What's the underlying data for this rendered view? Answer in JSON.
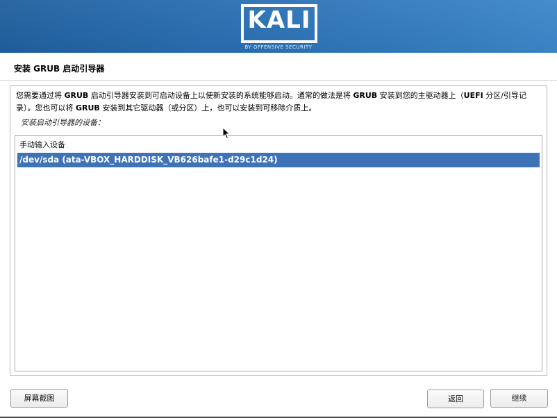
{
  "banner": {
    "logo": "KALI",
    "tagline": "BY OFFENSIVE SECURITY",
    "accent_color": "#2a70b4"
  },
  "page": {
    "title": "安装 GRUB 启动引导器",
    "description_parts": [
      "您需要通过将 ",
      "GRUB",
      " 启动引导器安装到可启动设备上以使新安装的系统能够启动。通常的做法是将 ",
      "GRUB",
      " 安装到您的主驱动器上（",
      "UEFI",
      " 分区/引导记录）。您也可以将 ",
      "GRUB",
      " 安装到其它驱动器（或分区）上，也可以安装到可移除介质上。"
    ],
    "prompt": "安装启动引导器的设备："
  },
  "device_list": {
    "items": [
      {
        "label": "手动输入设备",
        "selected": false
      },
      {
        "label": "/dev/sda  (ata-VBOX_HARDDISK_VB626bafe1-d29c1d24)",
        "selected": true
      }
    ],
    "selection_color": "#3f73b8"
  },
  "buttons": {
    "screenshot": "屏幕截图",
    "back": "返回",
    "continue": "继续"
  }
}
